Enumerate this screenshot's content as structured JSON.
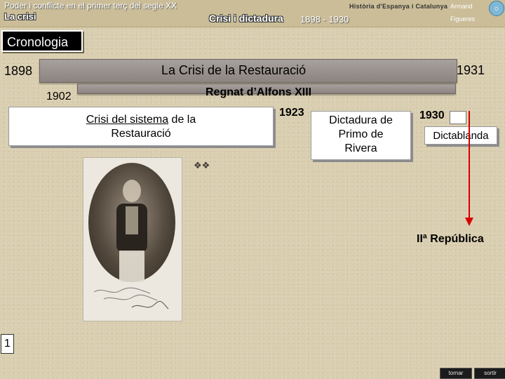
{
  "header": {
    "course_title": "Poder i conflicte en el primer terç del segle XX",
    "series_title": "Història d'Espanya i Catalunya",
    "author": "Armand",
    "place": "Figueres",
    "logo_text": "La crisi",
    "unit_title": "Crisi i dictadura",
    "unit_years": "1898 - 1930",
    "badge_icon": "circle-logo-icon"
  },
  "section": {
    "title": "Cronologia"
  },
  "timeline": {
    "start_year": "1898",
    "end_year": "1931",
    "crisis_title": "La Crisi de la Restauració",
    "reign_start": "1902",
    "reign_title": "Regnat d’Alfons XIII",
    "crisis_card": {
      "part1": "Crisi del sistema",
      "part2": " de la",
      "line2": "Restauració"
    },
    "dictatorship_year": "1923",
    "dictatorship_card": {
      "line1": "Dictadura de",
      "line2": "Primo de",
      "line3": "Rivera"
    },
    "dictablanda_year": "1930",
    "dictablanda_label": "Dictablanda",
    "republic_label": "IIª República",
    "arrow_color": "#d80000"
  },
  "photo": {
    "subject": "portrait-photo"
  },
  "footer": {
    "page_number": "1",
    "back_label": "tornar",
    "exit_label": "sortir"
  }
}
